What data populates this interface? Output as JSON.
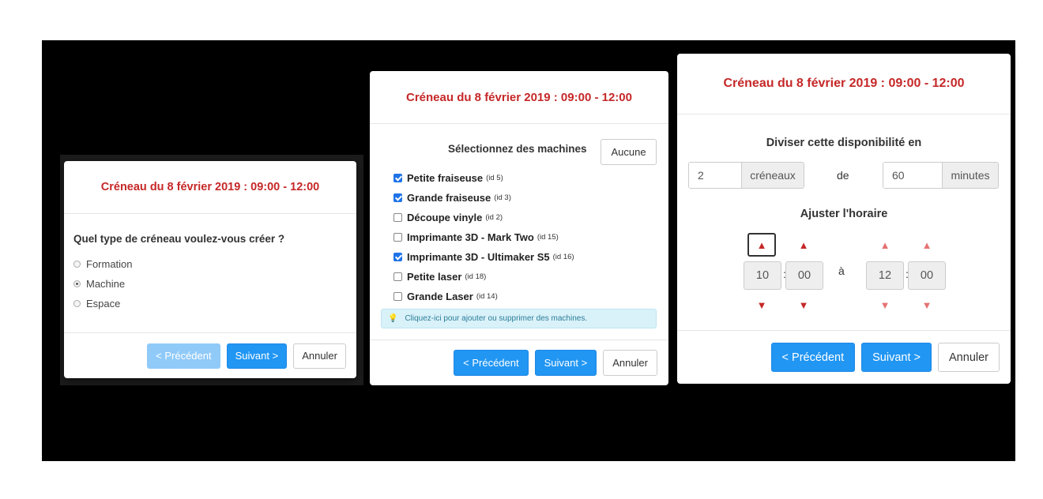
{
  "wizard_type": {
    "title": "Créneau du 8 février 2019 : 09:00 - 12:00",
    "question": "Quel type de créneau voulez-vous créer ?",
    "options": [
      {
        "label": "Formation",
        "checked": false
      },
      {
        "label": "Machine",
        "checked": true
      },
      {
        "label": "Espace",
        "checked": false
      }
    ],
    "prev_label": "< Précédent",
    "next_label": "Suivant >",
    "cancel_label": "Annuler"
  },
  "wizard_machines": {
    "title": "Créneau du 8 février 2019 : 09:00 - 12:00",
    "select_label": "Sélectionnez des machines",
    "none_label": "Aucune",
    "machines": [
      {
        "name": "Petite fraiseuse",
        "id_label": "(id 5)",
        "checked": true
      },
      {
        "name": "Grande fraiseuse",
        "id_label": "(id 3)",
        "checked": true
      },
      {
        "name": "Découpe vinyle",
        "id_label": "(id 2)",
        "checked": false
      },
      {
        "name": "Imprimante 3D - Mark Two",
        "id_label": "(id 15)",
        "checked": false
      },
      {
        "name": "Imprimante 3D - Ultimaker S5",
        "id_label": "(id 16)",
        "checked": true
      },
      {
        "name": "Petite laser",
        "id_label": "(id 18)",
        "checked": false
      },
      {
        "name": "Grande Laser",
        "id_label": "(id 14)",
        "checked": false
      }
    ],
    "info_icon": "lightbulb-icon",
    "info_text": "Cliquez-ici pour ajouter ou supprimer des machines.",
    "prev_label": "< Précédent",
    "next_label": "Suivant >",
    "cancel_label": "Annuler"
  },
  "wizard_split": {
    "title": "Créneau du 8 février 2019 : 09:00 - 12:00",
    "divide_label": "Diviser cette disponibilité en",
    "slots_value": "2",
    "slots_unit": "créneaux",
    "of_label": "de",
    "minutes_value": "60",
    "minutes_unit": "minutes",
    "adjust_label": "Ajuster l'horaire",
    "start_hour": "10",
    "start_minute": "00",
    "to_label": "à",
    "end_hour": "12",
    "end_minute": "00",
    "colon": ":",
    "prev_label": "< Précédent",
    "next_label": "Suivant >",
    "cancel_label": "Annuler"
  },
  "colors": {
    "title_red": "#c62828",
    "primary_blue": "#2196f3",
    "backdrop": "#000000",
    "info_bg": "#d9f1f8"
  }
}
